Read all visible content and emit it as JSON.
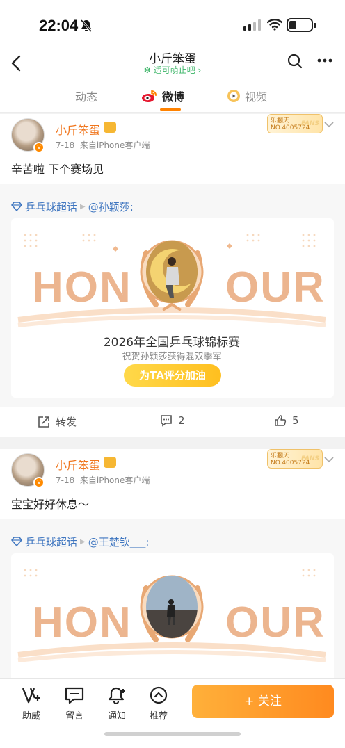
{
  "status_bar": {
    "time": "22:04"
  },
  "nav": {
    "title": "小斤笨蛋",
    "subtitle": "适可萌止吧",
    "subtitle_chevron": "›"
  },
  "tabs": [
    {
      "label": "动态"
    },
    {
      "label": "微博"
    },
    {
      "label": "视频"
    }
  ],
  "fan_badge": {
    "line1": "乐翻天",
    "line2": "NO.4005724",
    "mark": "FANS"
  },
  "posts": [
    {
      "username": "小斤笨蛋",
      "date": "7-18",
      "source": "来自iPhone客户端",
      "text": "辛苦啦 下个赛场见",
      "topic": "乒乓球超话",
      "mention": "@孙颖莎:",
      "card": {
        "word_left": "HON",
        "word_right": "OUR",
        "title": "2026年全国乒乓球锦标赛",
        "subtitle": "祝贺孙颖莎获得混双季军",
        "button": "为TA评分加油"
      },
      "actions": {
        "repost": "转发",
        "comments": "2",
        "likes": "5"
      }
    },
    {
      "username": "小斤笨蛋",
      "date": "7-18",
      "source": "来自iPhone客户端",
      "text": "宝宝好好休息～",
      "topic": "乒乓球超话",
      "mention": "@王楚钦___:",
      "card": {
        "word_left": "HON",
        "word_right": "OUR"
      }
    }
  ],
  "bottom_bar": {
    "items": [
      {
        "label": "助威",
        "icon": "cheer-icon"
      },
      {
        "label": "留言",
        "icon": "message-icon"
      },
      {
        "label": "通知",
        "icon": "bell-plus-icon"
      },
      {
        "label": "推荐",
        "icon": "recommend-icon"
      }
    ],
    "follow": "+ 关注"
  },
  "colors": {
    "accent": "#ff8200",
    "username": "#f0751c",
    "link": "#3f76c0",
    "follow": "#ff8a1f"
  }
}
